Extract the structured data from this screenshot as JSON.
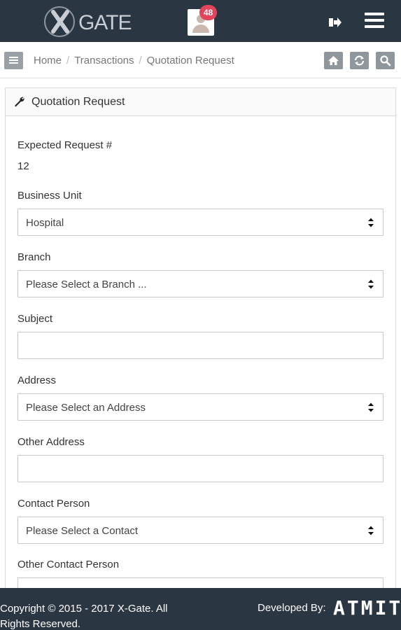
{
  "header": {
    "logo_text": "GATE",
    "notifications_count": "48",
    "icons": {
      "logout": "logout-icon",
      "menu": "hamburger-menu-icon",
      "avatar": "user-avatar-icon"
    }
  },
  "breadcrumb": {
    "items": [
      "Home",
      "Transactions",
      "Quotation Request"
    ],
    "tools": [
      "home-icon",
      "refresh-icon",
      "search-icon"
    ]
  },
  "panel": {
    "title": "Quotation Request",
    "icon": "wrench-icon"
  },
  "form": {
    "expected_request_label": "Expected Request #",
    "expected_request_value": "12",
    "business_unit_label": "Business Unit",
    "business_unit_value": "Hospital",
    "branch_label": "Branch",
    "branch_value": "Please Select a Branch ...",
    "subject_label": "Subject",
    "subject_value": "",
    "address_label": "Address",
    "address_value": "Please Select an Address",
    "other_address_label": "Other Address",
    "other_address_value": "",
    "contact_person_label": "Contact Person",
    "contact_person_value": "Please Select a Contact",
    "other_contact_person_label": "Other Contact Person"
  },
  "footer": {
    "copyright": "Copyright © 2015 - 2017 X-Gate. All Rights Reserved.",
    "developed_by": "Developed By:",
    "brand": "ATMIT"
  },
  "colors": {
    "topbar": "#2b3643",
    "badge": "#e2445c",
    "tool_button": "#8f969c"
  }
}
